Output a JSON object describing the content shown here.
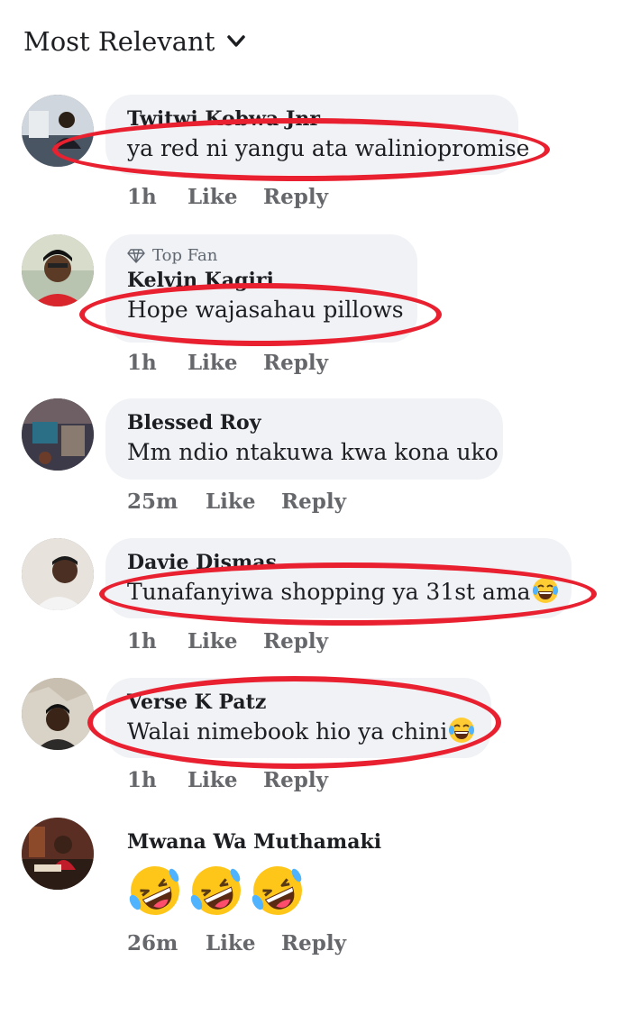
{
  "header": {
    "sort_label": "Most Relevant"
  },
  "comments": [
    {
      "author": "Twitwi Kobwa Jnr",
      "text": "ya red ni yangu ata waliniopromise",
      "time": "1h",
      "like": "Like",
      "reply": "Reply"
    },
    {
      "badge": "Top Fan",
      "author": "Kelvin Kagiri",
      "text": "Hope wajasahau pillows",
      "time": "1h",
      "like": "Like",
      "reply": "Reply"
    },
    {
      "author": "Blessed Roy",
      "text": "Mm ndio ntakuwa kwa kona uko",
      "time": "25m",
      "like": "Like",
      "reply": "Reply"
    },
    {
      "author": "Davie Dismas",
      "text": "Tunafanyiwa shopping ya 31st ama",
      "emoji": "face-with-tears-of-joy",
      "time": "1h",
      "like": "Like",
      "reply": "Reply"
    },
    {
      "author": "Verse K Patz",
      "text": "Walai nimebook hio ya chini",
      "emoji": "face-with-tears-of-joy",
      "time": "1h",
      "like": "Like",
      "reply": "Reply"
    },
    {
      "author": "Mwana Wa Muthamaki",
      "emojis": [
        "rolling-on-floor-laughing",
        "rolling-on-floor-laughing",
        "rolling-on-floor-laughing"
      ],
      "time": "26m",
      "like": "Like",
      "reply": "Reply"
    }
  ],
  "colors": {
    "highlight_oval": "#e8202f",
    "bubble": "#f0f2f5",
    "meta_text": "#65676b"
  }
}
